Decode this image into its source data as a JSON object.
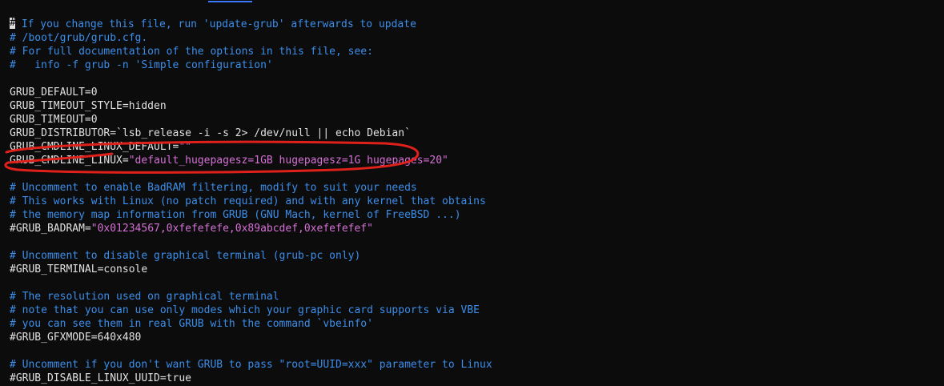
{
  "editor": {
    "cursor_char": "#",
    "lines": [
      {
        "type": "comment",
        "rest": " If you change this file, run 'update-grub' afterwards to update"
      },
      {
        "type": "comment",
        "text": "# /boot/grub/grub.cfg."
      },
      {
        "type": "comment",
        "text": "# For full documentation of the options in this file, see:"
      },
      {
        "type": "comment",
        "text": "#   info -f grub -n 'Simple configuration'"
      },
      {
        "type": "blank",
        "text": ""
      },
      {
        "type": "plain",
        "text": "GRUB_DEFAULT=0"
      },
      {
        "type": "plain",
        "text": "GRUB_TIMEOUT_STYLE=hidden"
      },
      {
        "type": "plain",
        "text": "GRUB_TIMEOUT=0"
      },
      {
        "type": "plain",
        "text": "GRUB_DISTRIBUTOR=`lsb_release -i -s 2> /dev/null || echo Debian`"
      },
      {
        "type": "assign",
        "key": "GRUB_CMDLINE_LINUX_DEFAULT=",
        "value": "\"\""
      },
      {
        "type": "assign",
        "key": "GRUB_CMDLINE_LINUX=",
        "value": "\"default_hugepagesz=1GB hugepagesz=1G hugepages=20\""
      },
      {
        "type": "blank",
        "text": ""
      },
      {
        "type": "comment",
        "text": "# Uncomment to enable BadRAM filtering, modify to suit your needs"
      },
      {
        "type": "comment",
        "text": "# This works with Linux (no patch required) and with any kernel that obtains"
      },
      {
        "type": "comment",
        "text": "# the memory map information from GRUB (GNU Mach, kernel of FreeBSD ...)"
      },
      {
        "type": "assign",
        "key": "#GRUB_BADRAM=",
        "value": "\"0x01234567,0xfefefefe,0x89abcdef,0xefefefef\""
      },
      {
        "type": "blank",
        "text": ""
      },
      {
        "type": "comment",
        "text": "# Uncomment to disable graphical terminal (grub-pc only)"
      },
      {
        "type": "plain",
        "text": "#GRUB_TERMINAL=console"
      },
      {
        "type": "blank",
        "text": ""
      },
      {
        "type": "comment",
        "text": "# The resolution used on graphical terminal"
      },
      {
        "type": "comment",
        "text": "# note that you can use only modes which your graphic card supports via VBE"
      },
      {
        "type": "comment",
        "text": "# you can see them in real GRUB with the command `vbeinfo'"
      },
      {
        "type": "plain",
        "text": "#GRUB_GFXMODE=640x480"
      },
      {
        "type": "blank",
        "text": ""
      },
      {
        "type": "comment",
        "text": "# Uncomment if you don't want GRUB to pass \"root=UUID=xxx\" parameter to Linux"
      },
      {
        "type": "plain",
        "text": "#GRUB_DISABLE_LINUX_UUID=true"
      }
    ]
  },
  "colors": {
    "comment": "#3b8eea",
    "plain": "#e0e0e0",
    "string": "#d670d6",
    "annotation": "#e0201a"
  }
}
